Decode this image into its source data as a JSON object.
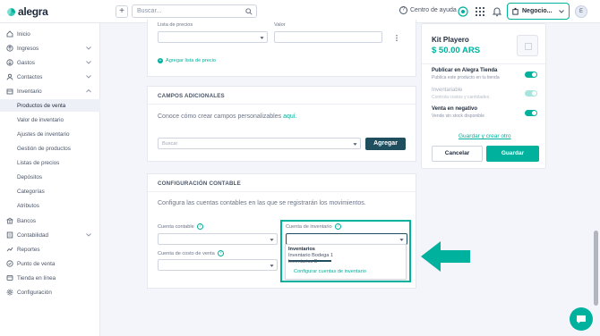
{
  "header": {
    "brand": "alegra",
    "search_placeholder": "Buscar...",
    "help_label": "Centro de ayuda",
    "company": "Negocio...",
    "avatar_initial": "E"
  },
  "sidebar": {
    "items": [
      {
        "label": "Inicio",
        "icon": "home-icon"
      },
      {
        "label": "Ingresos",
        "icon": "income-icon"
      },
      {
        "label": "Gastos",
        "icon": "expenses-icon"
      },
      {
        "label": "Contactos",
        "icon": "contacts-icon"
      },
      {
        "label": "Inventario",
        "icon": "inventory-icon"
      }
    ],
    "inventory_sub": [
      "Productos de venta",
      "Valor de inventario",
      "Ajustes de inventario",
      "Gestión de productos",
      "Listas de precios",
      "Depósitos",
      "Categorías",
      "Atributos"
    ],
    "bottom_items": [
      {
        "label": "Bancos",
        "icon": "bank-icon"
      },
      {
        "label": "Contabilidad",
        "icon": "accounting-icon"
      },
      {
        "label": "Reportes",
        "icon": "reports-icon"
      },
      {
        "label": "Punto de venta",
        "icon": "pos-icon"
      },
      {
        "label": "Tienda en línea",
        "icon": "store-icon"
      },
      {
        "label": "Configuración",
        "icon": "settings-icon"
      }
    ]
  },
  "prices": {
    "list_label": "Lista de precios",
    "value_label": "Valor",
    "add_link": "Agregar lista de precio"
  },
  "additional": {
    "title": "CAMPOS ADICIONALES",
    "text": "Conoce cómo crear campos personalizables",
    "link": "aquí.",
    "search_placeholder": "Buscar",
    "add_button": "Agregar"
  },
  "accounting": {
    "title": "CONFIGURACIÓN CONTABLE",
    "text": "Configura las cuentas contables en las que se registrarán los movimientos.",
    "account_label": "Cuenta contable",
    "cost_label": "Cuenta de costo de venta",
    "inventory_label": "Cuenta de inventario",
    "dropdown": {
      "group": "Inventarios",
      "options": [
        "Inventario Bodega 1",
        "Inventarios B"
      ],
      "configure_link": "Configurar cuentas de inventario"
    }
  },
  "product": {
    "name": "Kit Playero",
    "price": "$ 50.00 ARS",
    "options": [
      {
        "title": "Publicar en Alegra Tienda",
        "desc": "Publica este producto en tu tienda",
        "on": true
      },
      {
        "title": "Inventariable",
        "desc": "Controla costos y cantidades",
        "on": true
      },
      {
        "title": "Venta en negativo",
        "desc": "Vende sin stock disponible",
        "on": true
      }
    ],
    "save_create_link": "Guardar y crear otro",
    "cancel": "Cancelar",
    "save": "Guardar"
  },
  "colors": {
    "accent": "#00b19d",
    "dark_button": "#1f4e5f"
  }
}
